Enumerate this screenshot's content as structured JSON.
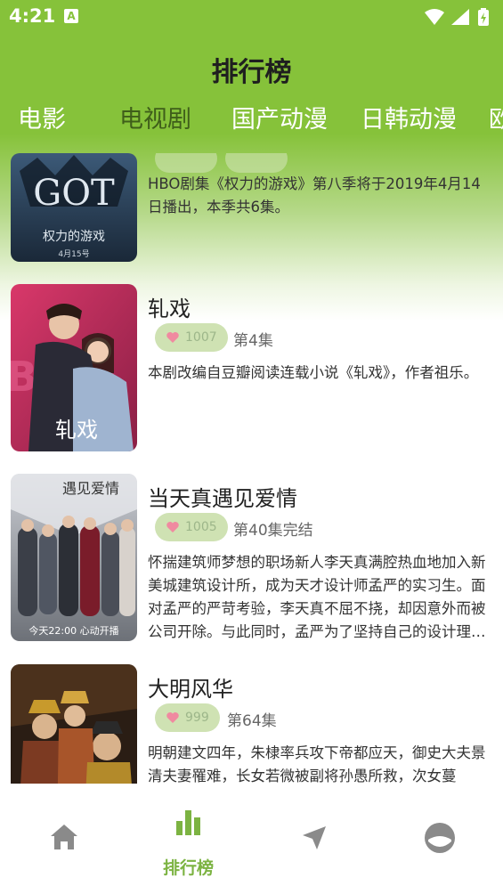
{
  "status_bar": {
    "time": "4:21",
    "notification_glyph": "A"
  },
  "header": {
    "title": "排行榜"
  },
  "tabs": [
    {
      "label": "电影",
      "active": false
    },
    {
      "label": "电视剧",
      "active": true
    },
    {
      "label": "国产动漫",
      "active": false
    },
    {
      "label": "日韩动漫",
      "active": false
    },
    {
      "label": "欧",
      "active": false
    }
  ],
  "colors": {
    "accent": "#86c23a",
    "active_tab": "#3f5e1a",
    "like_pill": "#cfe2b3",
    "nav_active": "#7cb342",
    "nav_inactive": "#8a8a8a"
  },
  "list": [
    {
      "poster_text": "GOT",
      "poster_sub": "权力的游戏",
      "poster_date": "4月15号",
      "description": "HBO剧集《权力的游戏》第八季将于2019年4月14日播出，本季共6集。"
    },
    {
      "title": "轧戏",
      "likes": "1007",
      "episodes": "第4集",
      "poster_text": "轧戏",
      "description": "本剧改编自豆瓣阅读连载小说《轧戏》，作者祖乐。"
    },
    {
      "title": "当天真遇见爱情",
      "likes": "1005",
      "episodes": "第40集完结",
      "poster_text": "今天22:00 心动开播",
      "description": "怀揣建筑师梦想的职场新人李天真满腔热血地加入新美城建筑设计所，成为天才设计师孟严的实习生。面对孟严的严苛考验，李天真不屈不挠，却因意外而被公司开除。与此同时，孟严为了坚持自己的设计理念，与公司高层产生分歧……"
    },
    {
      "title": "大明风华",
      "likes": "999",
      "episodes": "第64集",
      "description": "明朝建文四年，朱棣率兵攻下帝都应天，御史大夫景清夫妻罹难，长女若微被副将孙愚所救，次女蔓"
    }
  ],
  "bottom_nav": [
    {
      "icon": "home-icon",
      "label": "",
      "active": false
    },
    {
      "icon": "bar-chart-icon",
      "label": "排行榜",
      "active": true
    },
    {
      "icon": "send-icon",
      "label": "",
      "active": false
    },
    {
      "icon": "profile-icon",
      "label": "",
      "active": false
    }
  ]
}
